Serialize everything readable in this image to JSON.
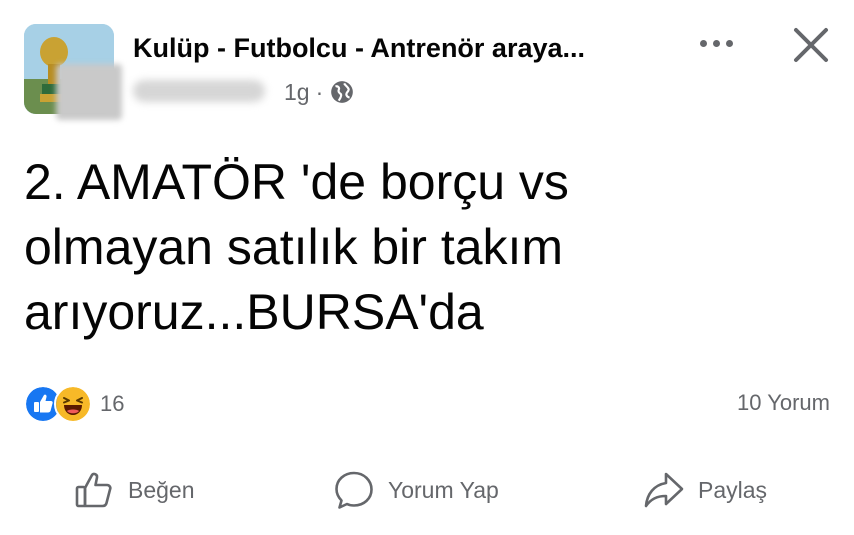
{
  "post": {
    "group_name": "Kulüp - Futbolcu - Antrenör araya...",
    "time": "1g",
    "separator": "·",
    "privacy_icon": "globe-icon",
    "text_lines": [
      "2. AMATÖR 'de borçu vs",
      "olmayan satılık bir takım",
      "arıyoruz...BURSA'da"
    ]
  },
  "reactions": {
    "icons": [
      "like-reaction-icon",
      "haha-reaction-icon"
    ],
    "count": "16",
    "comments": "10 Yorum"
  },
  "actions": {
    "like_label": "Beğen",
    "comment_label": "Yorum Yap",
    "share_label": "Paylaş"
  },
  "colors": {
    "text_primary": "#050505",
    "text_secondary": "#65676b",
    "like_blue": "#1877f2",
    "haha_yellow": "#f7b928"
  }
}
